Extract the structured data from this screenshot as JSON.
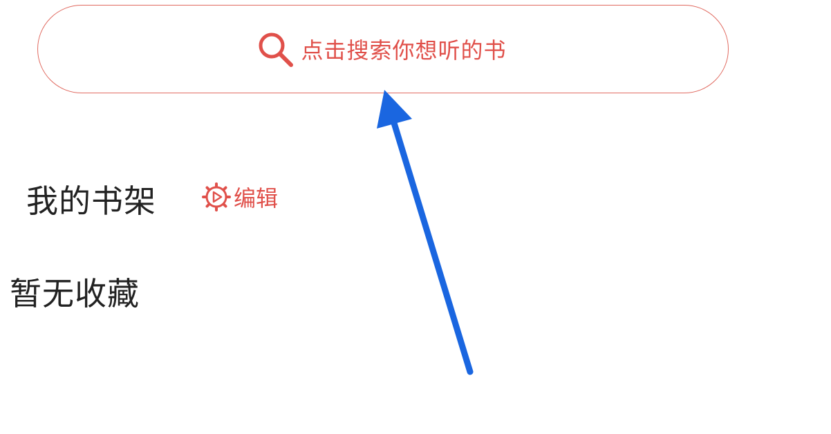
{
  "search": {
    "placeholder": "点击搜索你想听的书",
    "icon": "search-icon",
    "color": "#e0504a"
  },
  "shelf": {
    "title": "我的书架",
    "edit_label": "编辑",
    "edit_icon": "gear-play-icon"
  },
  "empty_state": {
    "text": "暂无收藏"
  },
  "annotation": {
    "type": "arrow",
    "color": "#1a66e0",
    "points_to": "search-bar"
  }
}
